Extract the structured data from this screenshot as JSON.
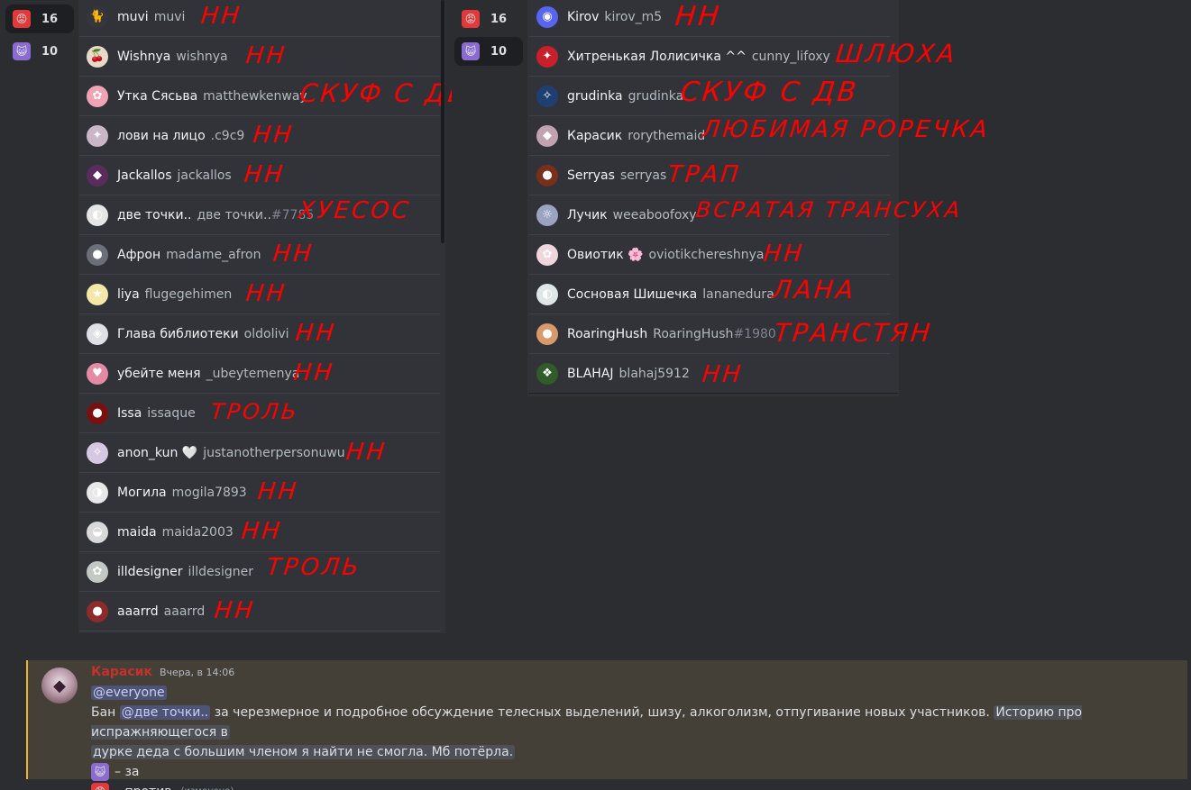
{
  "reactions": [
    {
      "emoji": "😡",
      "count": "16",
      "color": "#e23a3a"
    },
    {
      "emoji": "😺",
      "count": "10",
      "color": "#8b6bd1"
    }
  ],
  "left_list": [
    {
      "display": "muvi",
      "username": "muvi",
      "note": "НН",
      "avatar_color": "#35363b",
      "avatar_glyph": "🐈"
    },
    {
      "display": "Wishnya",
      "username": "wishnya",
      "note": "НН",
      "avatar_color": "#e8d9c9",
      "avatar_glyph": "🍒"
    },
    {
      "display": "Утка Сясьва",
      "username": "matthewkenway",
      "note": "СКУФ С ДВ",
      "avatar_color": "#f0a3b5",
      "avatar_glyph": "✿"
    },
    {
      "display": "лови на лицо",
      "username": ".c9c9",
      "note": "НН",
      "avatar_color": "#c9b7c8",
      "avatar_glyph": "✦"
    },
    {
      "display": "Jackallos",
      "username": "jackallos",
      "note": "НН",
      "avatar_color": "#5a2c5e",
      "avatar_glyph": "◆"
    },
    {
      "display": "две точки..",
      "username": "две точки..",
      "disc": "#7785",
      "note": "ХУЕСОС",
      "avatar_color": "#e6e6e6",
      "avatar_glyph": "◐"
    },
    {
      "display": "Афрон",
      "username": "madame_afron",
      "note": "НН",
      "avatar_color": "#6b6f7a",
      "avatar_glyph": "●"
    },
    {
      "display": "liya",
      "username": "flugegehimen",
      "note": "НН",
      "avatar_color": "#f5e7a8",
      "avatar_glyph": "★"
    },
    {
      "display": "Глава библиотеки",
      "username": "oldolivi",
      "note": "НН",
      "avatar_color": "#dfe0e6",
      "avatar_glyph": "◈"
    },
    {
      "display": "убейте меня",
      "username": "_ubeytemenya",
      "note": "НН",
      "avatar_color": "#e58aa4",
      "avatar_glyph": "♥"
    },
    {
      "display": "Issa",
      "username": "issaque",
      "note": "ТРОЛЬ",
      "avatar_color": "#7a1010",
      "avatar_glyph": "●"
    },
    {
      "display": "anon_kun 🤍",
      "username": "justanotherpersonuwu",
      "note": "НН",
      "avatar_color": "#d6c7e3",
      "avatar_glyph": "✧"
    },
    {
      "display": "Могила",
      "username": "mogila7893",
      "note": "НН",
      "avatar_color": "#e8e8e8",
      "avatar_glyph": "◑"
    },
    {
      "display": "maida",
      "username": "maida2003",
      "note": "НН",
      "avatar_color": "#d9d9d9",
      "avatar_glyph": "◒"
    },
    {
      "display": "illdesigner",
      "username": "illdesigner",
      "note": "ТРОЛЬ",
      "avatar_color": "#c2c9c4",
      "avatar_glyph": "✿"
    },
    {
      "display": "aaarrd",
      "username": "aaarrd",
      "note": "НН",
      "avatar_color": "#8d2b2b",
      "avatar_glyph": "●"
    }
  ],
  "right_list": [
    {
      "display": "Kirov",
      "username": "kirov_m5",
      "note": "НН",
      "avatar_color": "#5865f2",
      "avatar_glyph": "◉"
    },
    {
      "display": "Хитренькая Лолисичка ^^",
      "username": "cunny_lifoxy",
      "note": "ШЛЮХА",
      "avatar_color": "#c8202a",
      "avatar_glyph": "✦"
    },
    {
      "display": "grudinka",
      "username": "grudinka",
      "note": "СКУФ С ДВ",
      "avatar_color": "#1f3f73",
      "avatar_glyph": "✧"
    },
    {
      "display": "Карасик",
      "username": "rorythemaid",
      "note": "ЛЮБИМАЯ РОРЕЧКА",
      "avatar_color": "#c1a2b0",
      "avatar_glyph": "◆"
    },
    {
      "display": "Serryas",
      "username": "serryas",
      "note": "ТРАП",
      "avatar_color": "#7a2e1c",
      "avatar_glyph": "●"
    },
    {
      "display": "Лучик",
      "username": "weeaboofoxy",
      "note": "ВСРАТАЯ ТРАНСУХА",
      "avatar_color": "#9aa3c0",
      "avatar_glyph": "☼"
    },
    {
      "display": "Овиотик 🌸",
      "username": "oviotikchereshnya",
      "note": "НН",
      "avatar_color": "#f0d6dc",
      "avatar_glyph": "✿"
    },
    {
      "display": "Сосновая Шишечка",
      "username": "lananedura",
      "note": "ЛАНА",
      "avatar_color": "#dfe6e6",
      "avatar_glyph": "◐"
    },
    {
      "display": "RoaringHush",
      "username": "RoaringHush",
      "disc": "#1980",
      "note": "ТРАНСТЯН",
      "avatar_color": "#d99a6b",
      "avatar_glyph": "●"
    },
    {
      "display": "BLAHAJ",
      "username": "blahaj5912",
      "note": "НН",
      "avatar_color": "#2f5c2a",
      "avatar_glyph": "❖"
    }
  ],
  "message": {
    "author": "Карасик",
    "timestamp": "Вчера, в 14:06",
    "mention_all": "@everyone",
    "line1_prefix": "Бан ",
    "mention_user": "@две точки..",
    "line1_rest": " за черезмерное и подробное обсуждение телесных выделений, шизу, алкоголизм, отпугивание новых участников.",
    "spoiler_part1": "Историю про испражняющегося в",
    "spoiler_part2": "дурке деда с большим членом я найти не смогла. Мб потёрла.",
    "vote_for": "– за",
    "vote_against": "– против",
    "edited": "(изменено)"
  }
}
